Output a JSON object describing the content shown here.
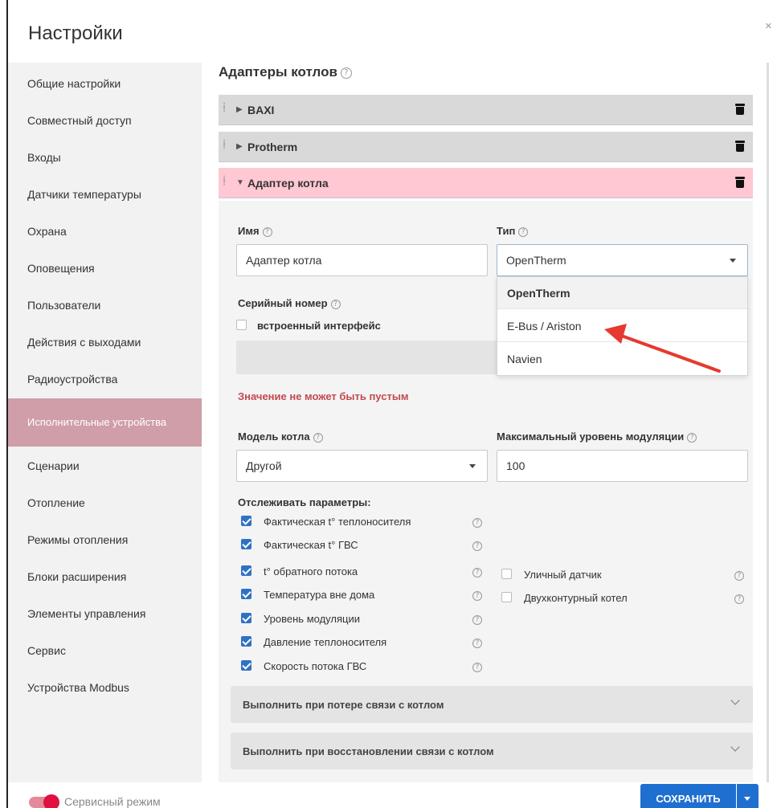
{
  "window": {
    "title": "Настройки",
    "close_symbol": "×"
  },
  "sidebar": {
    "items": [
      {
        "label": "Общие настройки"
      },
      {
        "label": "Совместный доступ"
      },
      {
        "label": "Входы"
      },
      {
        "label": "Датчики температуры"
      },
      {
        "label": "Охрана"
      },
      {
        "label": "Оповещения"
      },
      {
        "label": "Пользователи"
      },
      {
        "label": "Действия с выходами"
      },
      {
        "label": "Радиоустройства"
      },
      {
        "label": "Исполнительные устройства",
        "active": true
      },
      {
        "label": "Сценарии"
      },
      {
        "label": "Отопление"
      },
      {
        "label": "Режимы отопления"
      },
      {
        "label": "Блоки расширения"
      },
      {
        "label": "Элементы управления"
      },
      {
        "label": "Сервис"
      },
      {
        "label": "Устройства Modbus"
      }
    ],
    "active_color": "#cf9ea8"
  },
  "main": {
    "title": "Адаптеры котлов",
    "adapters": [
      {
        "label": "BAXI",
        "expanded": false
      },
      {
        "label": "Protherm",
        "expanded": false
      },
      {
        "label": "Адаптер котла",
        "expanded": true
      }
    ],
    "form": {
      "name_label": "Имя",
      "name_value": "Адаптер котла",
      "type_label": "Тип",
      "type_value": "OpenTherm",
      "type_options": [
        "OpenTherm",
        "E-Bus / Ariston",
        "Navien"
      ],
      "serial_label": "Серийный номер",
      "builtin_label": "встроенный интерфейс",
      "builtin_checked": false,
      "error_text": "Значение не может быть пустым",
      "model_label": "Модель котла",
      "model_value": "Другой",
      "modulation_label": "Максимальный уровень модуляции",
      "modulation_value": "100",
      "track_label": "Отслеживать параметры:",
      "params_left": [
        {
          "label": "Фактическая t° теплоносителя",
          "checked": true
        },
        {
          "label": "Фактическая t° ГВС",
          "checked": true
        },
        {
          "label": "t° обратного потока",
          "checked": true
        },
        {
          "label": "Температура вне дома",
          "checked": true
        },
        {
          "label": "Уровень модуляции",
          "checked": true
        },
        {
          "label": "Давление теплоносителя",
          "checked": true
        },
        {
          "label": "Скорость потока ГВС",
          "checked": true
        }
      ],
      "params_right": [
        {
          "label": "Уличный датчик",
          "checked": false
        },
        {
          "label": "Двухконтурный котел",
          "checked": false
        }
      ],
      "on_connection_lost": "Выполнить при потере связи с котлом",
      "on_connection_restored": "Выполнить при восстановлении связи с котлом"
    }
  },
  "footer": {
    "service_mode_label": "Сервисный режим",
    "service_mode_on": true,
    "save_label": "СОХРАНИТЬ"
  },
  "colors": {
    "accent_blue": "#1f6fd1",
    "expanded_header": "#ffc8d3",
    "error_red": "#c24a4f",
    "annotation_arrow": "#e53a2f"
  },
  "help_symbol": "?"
}
